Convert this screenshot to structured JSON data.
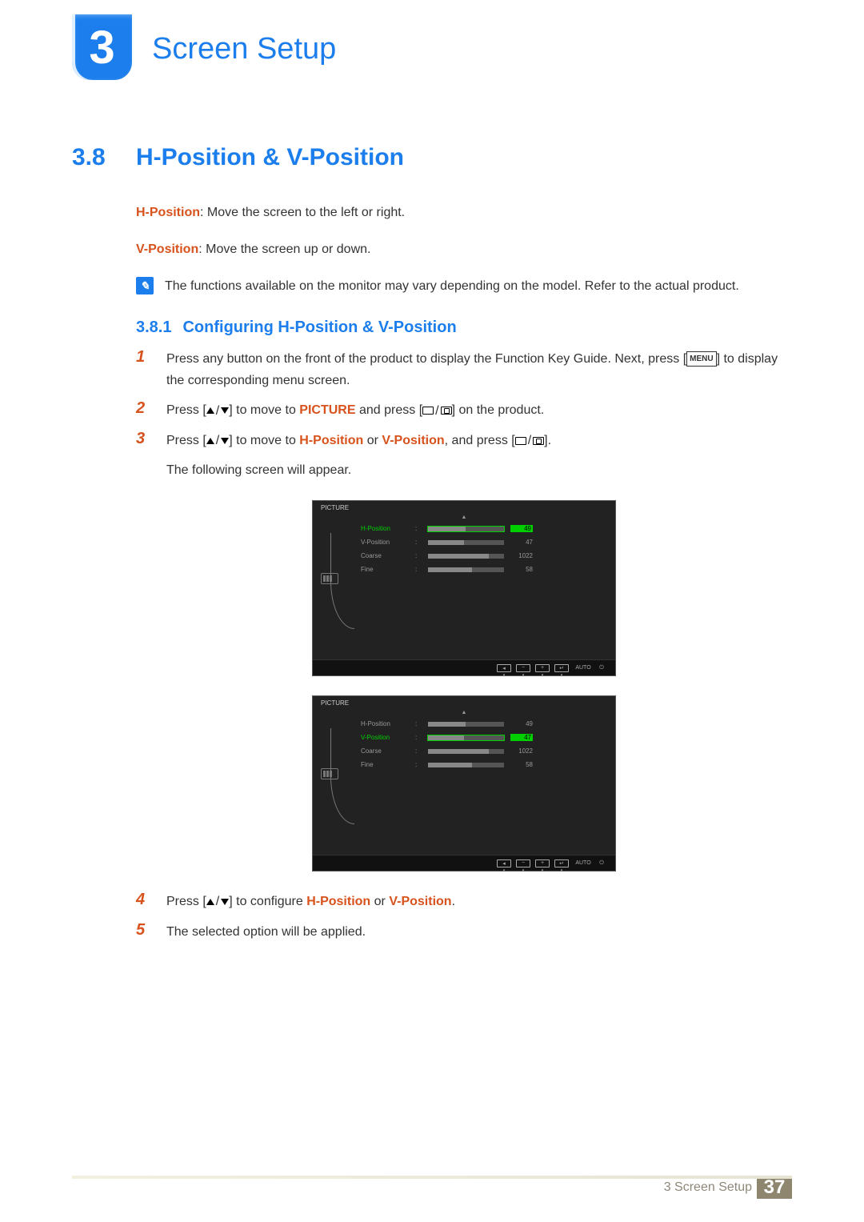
{
  "chapter": {
    "number": "3",
    "title": "Screen Setup"
  },
  "section": {
    "number": "3.8",
    "title": "H-Position & V-Position"
  },
  "intro": {
    "h_label": "H-Position",
    "h_text": ": Move the screen to the left or right.",
    "v_label": "V-Position",
    "v_text": ": Move the screen up or down."
  },
  "note": "The functions available on the monitor may vary depending on the model. Refer to the actual product.",
  "subsection": {
    "number": "3.8.1",
    "title": "Configuring H-Position & V-Position"
  },
  "steps": {
    "s1a": "Press any button on the front of the product to display the Function Key Guide. Next, press [",
    "s1_menu": "MENU",
    "s1b": "] to display the corresponding menu screen.",
    "s2a": "Press [",
    "s2b": "] to move to ",
    "s2_picture": "PICTURE",
    "s2c": " and press [",
    "s2d": "] on the product.",
    "s3a": "Press [",
    "s3b": "] to move to ",
    "s3_h": "H-Position",
    "s3_or1": " or ",
    "s3_v": "V-Position",
    "s3c": ", and press [",
    "s3d": "].",
    "s3e": "The following screen will appear.",
    "s4a": "Press [",
    "s4b": "] to configure ",
    "s4_h": "H-Position",
    "s4_or": " or ",
    "s4_v": "V-Position",
    "s4c": ".",
    "s5": "The selected option will be applied."
  },
  "osd": {
    "tab": "PICTURE",
    "rows": [
      {
        "label": "H-Position",
        "value": "49",
        "fill": 49
      },
      {
        "label": "V-Position",
        "value": "47",
        "fill": 47
      },
      {
        "label": "Coarse",
        "value": "1022",
        "fill": 80
      },
      {
        "label": "Fine",
        "value": "58",
        "fill": 58
      }
    ],
    "bottom": {
      "auto": "AUTO"
    }
  },
  "footer": {
    "label": "3 Screen Setup",
    "page": "37"
  }
}
